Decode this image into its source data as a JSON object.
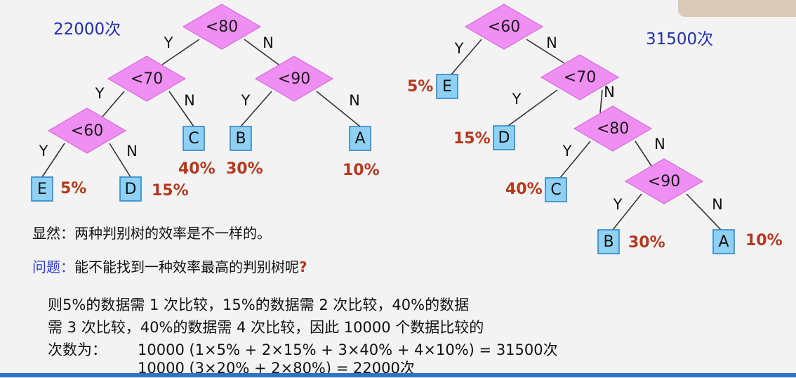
{
  "colors": {
    "diamond_fill": "#ef8ef3",
    "diamond_stroke": "#d86cdf",
    "leaf_fill": "#8fd0f5",
    "leaf_stroke": "#2f86c9",
    "percent_text": "#b5381e",
    "count_text": "#1f2fb0",
    "question_label": "#2a3fcf",
    "edge": "#333333"
  },
  "left_tree": {
    "count_label": "22000次",
    "decisions": [
      "<80",
      "<70",
      "<90",
      "<60"
    ],
    "leaves": [
      "E",
      "D",
      "C",
      "B",
      "A"
    ],
    "branch_labels": [
      "Y",
      "N",
      "Y",
      "N",
      "Y",
      "N",
      "Y",
      "N"
    ],
    "percents": [
      "5%",
      "15%",
      "40%",
      "30%",
      "10%"
    ]
  },
  "right_tree": {
    "count_label": "31500次",
    "decisions": [
      "<60",
      "<70",
      "<80",
      "<90"
    ],
    "leaves": [
      "E",
      "D",
      "C",
      "B",
      "A"
    ],
    "branch_labels": [
      "Y",
      "N",
      "Y",
      "N",
      "Y",
      "N",
      "Y",
      "N"
    ],
    "percents": [
      "5%",
      "15%",
      "40%",
      "30%",
      "10%"
    ]
  },
  "text": {
    "observation": "显然：两种判别树的效率是不一样的。",
    "question_label": "问题：",
    "question_body": "能不能找到一种效率最高的判别树呢",
    "question_mark": "?",
    "calc_line1": "则5%的数据需 1 次比较，15%的数据需 2 次比较，40%的数据",
    "calc_line2": "需 3 次比较，40%的数据需 4 次比较，因此 10000 个数据比较的",
    "calc_line3_prefix": "次数为：",
    "calc_line3_formula": "10000 (1×5% + 2×15% + 3×40% + 4×10%) = 31500次",
    "calc_line4_formula": "10000 (3×20% + 2×80%) = 22000次"
  }
}
